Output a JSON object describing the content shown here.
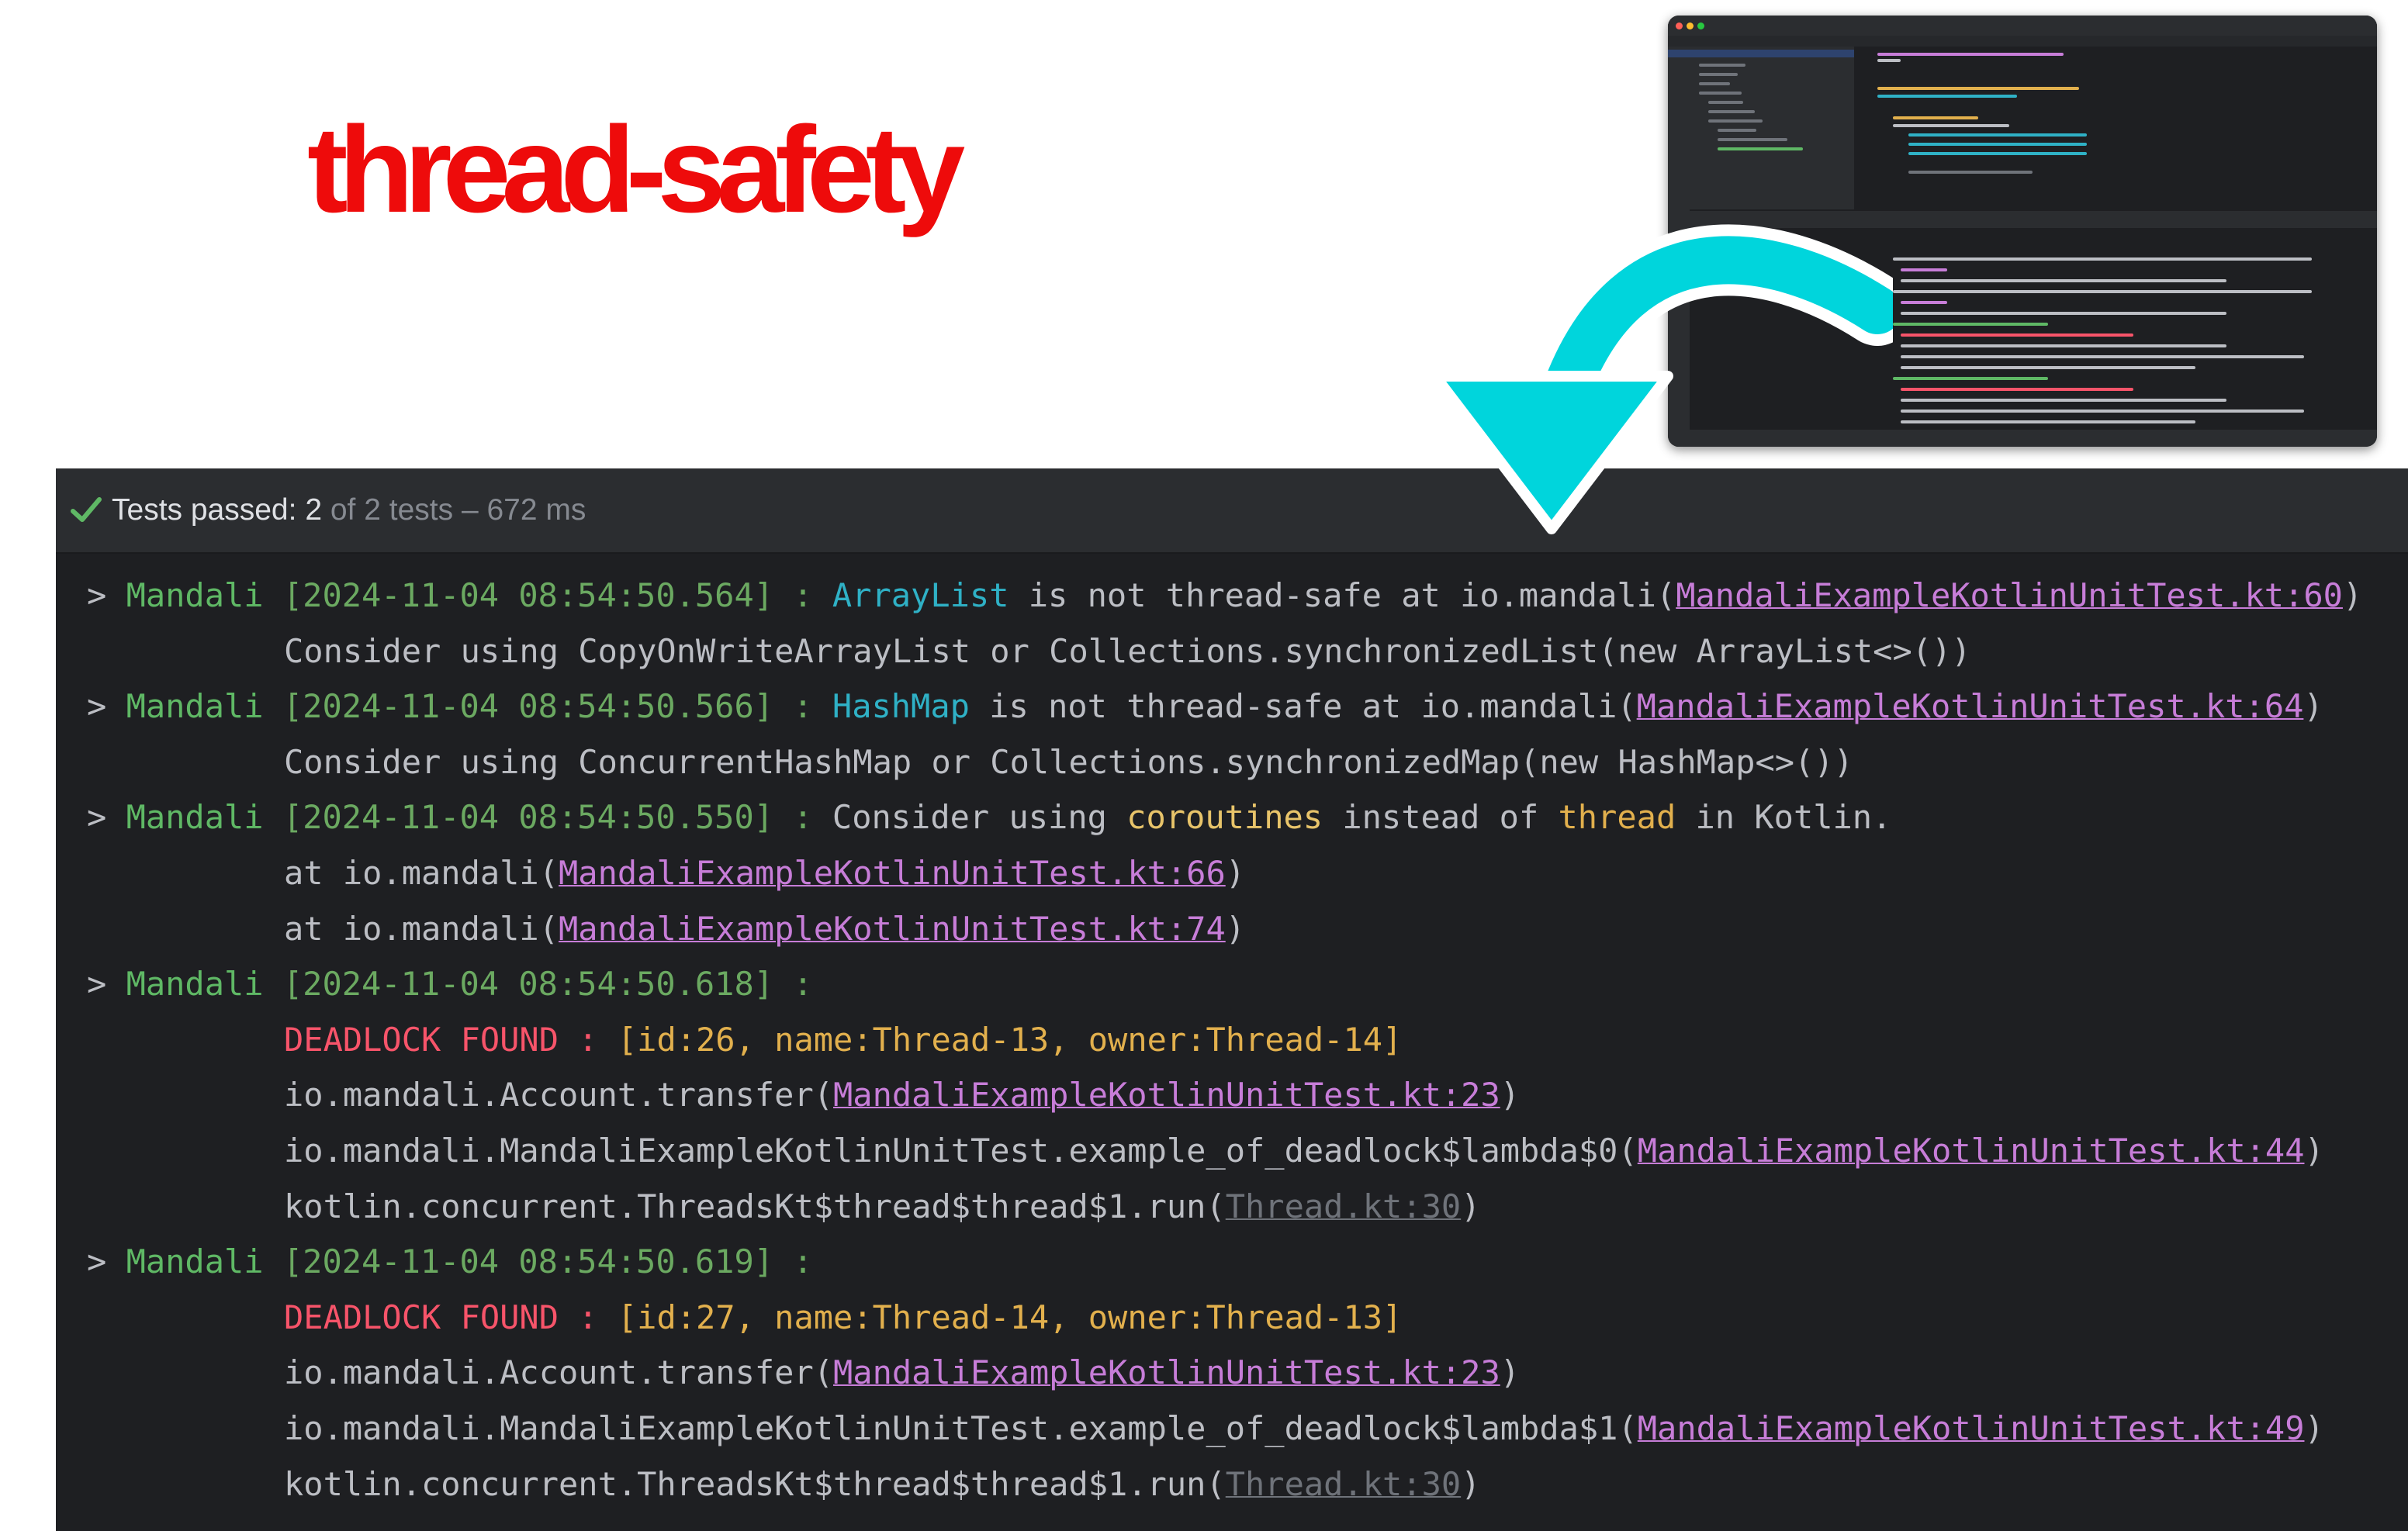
{
  "title": "thread-safety",
  "colors": {
    "accent_red": "#ee0b0b",
    "arrow": "#00d5dc",
    "console_bg": "#1e1f22",
    "link": "#c77dd8"
  },
  "header": {
    "passed_label": "Tests passed:",
    "passed_count": "2",
    "of_label": "of 2 tests",
    "duration": "– 672 ms",
    "status_icon": "check-icon"
  },
  "log": {
    "e1": {
      "prefix": "> ",
      "tag": "Mandali",
      "ts": " [2024-11-04 08:54:50.564] : ",
      "cls": "ArrayList",
      "msg": " is not thread-safe at io.mandali(",
      "link": "MandaliExampleKotlinUnitTest.kt:60",
      "close": ")",
      "hint": "Consider using CopyOnWriteArrayList or Collections.synchronizedList(new ArrayList<>())"
    },
    "e2": {
      "prefix": "> ",
      "tag": "Mandali",
      "ts": " [2024-11-04 08:54:50.566] : ",
      "cls": "HashMap",
      "msg": " is not thread-safe at io.mandali(",
      "link": "MandaliExampleKotlinUnitTest.kt:64",
      "close": ")",
      "hint": "Consider using ConcurrentHashMap or Collections.synchronizedMap(new HashMap<>())"
    },
    "e3": {
      "prefix": "> ",
      "tag": "Mandali",
      "ts": " [2024-11-04 08:54:50.550] : ",
      "p1": "Consider using ",
      "coroutines": "coroutines",
      "p2": " instead of ",
      "thread": "thread",
      "p3": " in Kotlin.",
      "at": "at io.mandali(",
      "link1": "MandaliExampleKotlinUnitTest.kt:66",
      "link2": "MandaliExampleKotlinUnitTest.kt:74",
      "close": ")"
    },
    "e4": {
      "prefix": "> ",
      "tag": "Mandali",
      "ts": " [2024-11-04 08:54:50.618] :",
      "dead": "DEADLOCK FOUND : ",
      "info": "[id:26, name:Thread-13, owner:Thread-14]",
      "t1": "io.mandali.Account.transfer(",
      "l1": "MandaliExampleKotlinUnitTest.kt:23",
      "t2": "io.mandali.MandaliExampleKotlinUnitTest.example_of_deadlock$lambda$0(",
      "l2": "MandaliExampleKotlinUnitTest.kt:44",
      "t3": "kotlin.concurrent.ThreadsKt$thread$thread$1.run(",
      "l3": "Thread.kt:30",
      "close": ")"
    },
    "e5": {
      "prefix": "> ",
      "tag": "Mandali",
      "ts": " [2024-11-04 08:54:50.619] :",
      "dead": "DEADLOCK FOUND : ",
      "info": "[id:27, name:Thread-14, owner:Thread-13]",
      "t1": "io.mandali.Account.transfer(",
      "l1": "MandaliExampleKotlinUnitTest.kt:23",
      "t2": "io.mandali.MandaliExampleKotlinUnitTest.example_of_deadlock$lambda$1(",
      "l2": "MandaliExampleKotlinUnitTest.kt:49",
      "t3": "kotlin.concurrent.ThreadsKt$thread$thread$1.run(",
      "l3": "Thread.kt:30",
      "close": ")"
    }
  }
}
